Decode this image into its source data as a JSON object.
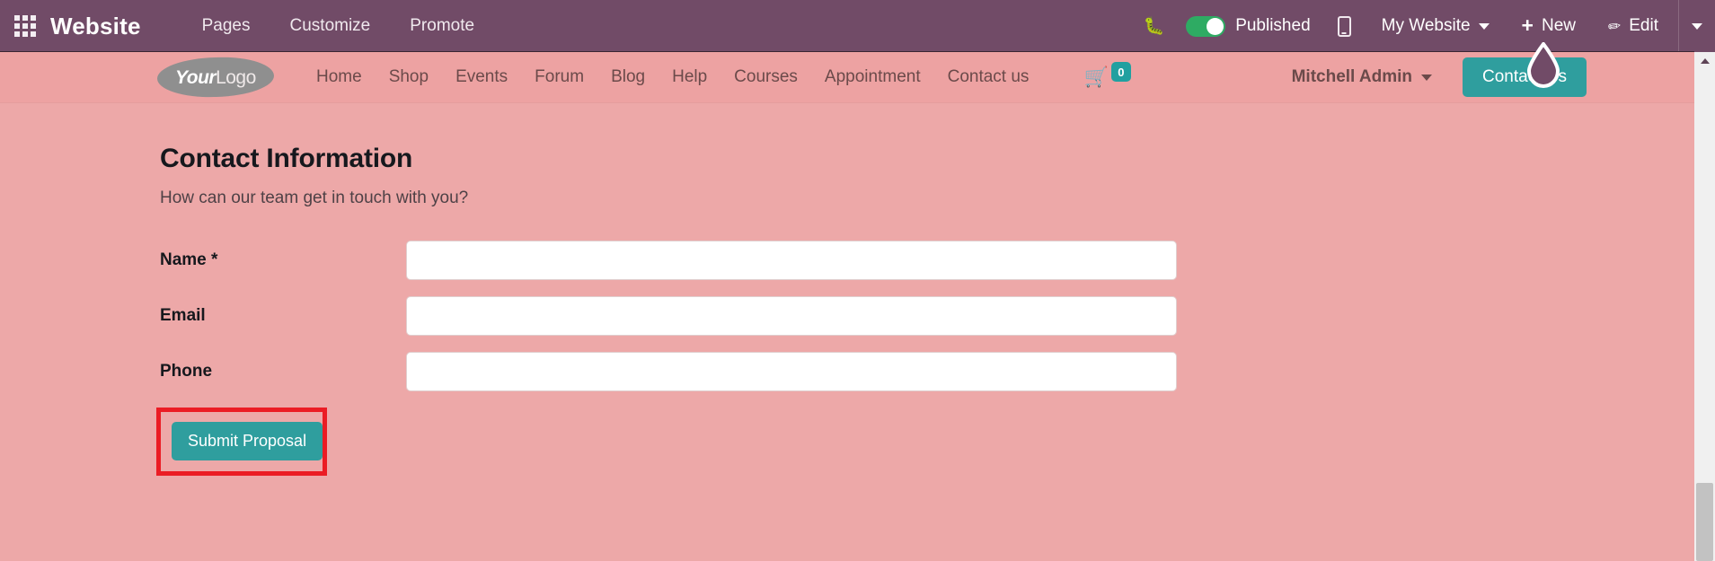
{
  "topbar": {
    "apps_icon": "apps-grid-icon",
    "brand": "Website",
    "menu": [
      {
        "label": "Pages"
      },
      {
        "label": "Customize"
      },
      {
        "label": "Promote"
      }
    ],
    "bug_icon": "bug-icon",
    "publish": {
      "label": "Published",
      "state": "on",
      "toggle_color": "#2eab63"
    },
    "mobile_icon": "mobile-preview-icon",
    "website_selector": {
      "label": "My Website",
      "caret": "chevron-down-icon"
    },
    "new_button": {
      "label": "New",
      "icon": "plus-icon"
    },
    "edit_button": {
      "label": "Edit",
      "icon": "pencil-icon"
    },
    "overflow_caret": "chevron-down-icon",
    "background_color": "#714b67"
  },
  "site_header": {
    "logo": {
      "bold_part": "Your",
      "light_part": "Logo"
    },
    "nav": [
      {
        "label": "Home"
      },
      {
        "label": "Shop"
      },
      {
        "label": "Events"
      },
      {
        "label": "Forum"
      },
      {
        "label": "Blog"
      },
      {
        "label": "Help"
      },
      {
        "label": "Courses"
      },
      {
        "label": "Appointment"
      },
      {
        "label": "Contact us"
      }
    ],
    "cart": {
      "icon": "shopping-cart-icon",
      "count": "0",
      "badge_color": "#21a0a0"
    },
    "user": {
      "name": "Mitchell Admin",
      "caret": "chevron-down-icon"
    },
    "cta_button": {
      "label": "Contact Us",
      "color": "#2f9e9e"
    },
    "background_color": "#eda2a2"
  },
  "page": {
    "title": "Contact Information",
    "subtitle": "How can our team get in touch with you?",
    "background_color": "#eda8a8",
    "form": {
      "fields": [
        {
          "label": "Name *",
          "value": "",
          "placeholder": ""
        },
        {
          "label": "Email",
          "value": "",
          "placeholder": ""
        },
        {
          "label": "Phone",
          "value": "",
          "placeholder": ""
        }
      ],
      "submit": {
        "label": "Submit Proposal",
        "color": "#2f9e9e"
      }
    }
  },
  "annotation": {
    "highlight_color": "#eb1c24",
    "target": "submit-proposal-button"
  },
  "cursor": {
    "type": "teardrop-pointer",
    "fill": "#714b67",
    "stroke": "#ffffff"
  },
  "scrollbar": {
    "arrow_up_icon": "triangle-up-icon",
    "thumb_color": "#c2c2c2",
    "track_color": "#f0f0f0"
  }
}
